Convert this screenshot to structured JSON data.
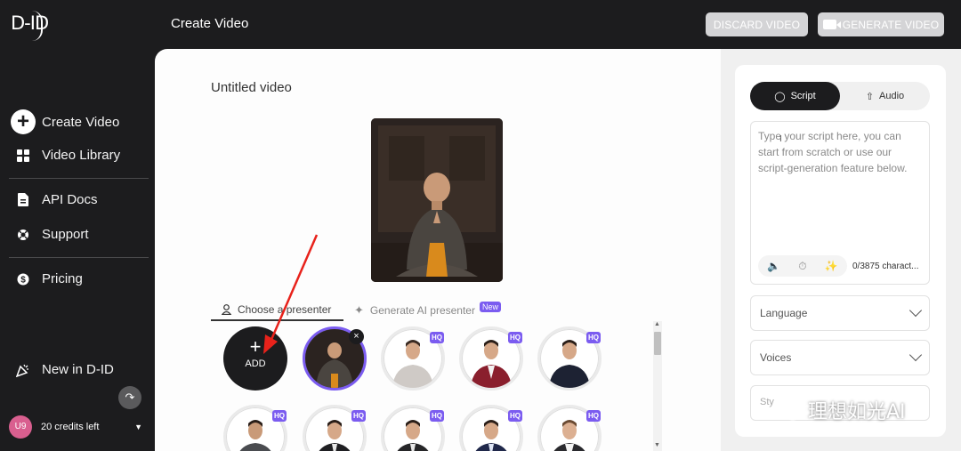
{
  "brand": {
    "logo": "D-ID"
  },
  "sidebar": {
    "items": [
      {
        "label": "Create Video",
        "icon": "plus-circle-icon"
      },
      {
        "label": "Video Library",
        "icon": "grid-icon"
      },
      {
        "label": "API Docs",
        "icon": "document-icon"
      },
      {
        "label": "Support",
        "icon": "lifebuoy-icon"
      },
      {
        "label": "Pricing",
        "icon": "dollar-icon"
      },
      {
        "label": "New in D-ID",
        "icon": "party-icon"
      }
    ],
    "user": {
      "initials": "U9",
      "credits": "20 credits left"
    }
  },
  "header": {
    "title": "Create Video",
    "discard_label": "DISCARD VIDEO",
    "generate_label": "GENERATE VIDEO"
  },
  "main": {
    "video_title": "Untitled video",
    "tabs": {
      "choose": "Choose a presenter",
      "generate": "Generate AI presenter",
      "new_badge": "New"
    },
    "add_label": "ADD",
    "hq_label": "HQ"
  },
  "right_panel": {
    "tabs": {
      "script": "Script",
      "audio": "Audio"
    },
    "script_placeholder": "Type your script here, you can start from scratch or use our script-generation feature below.",
    "char_count": "0/3875 charact...",
    "language_label": "Language",
    "voices_label": "Voices",
    "style_label": "Sty"
  },
  "watermark": {
    "text": "理想如光AI"
  },
  "colors": {
    "accent": "#7b5cf0",
    "dark": "#1c1c1e",
    "arrow": "#e8221b"
  }
}
